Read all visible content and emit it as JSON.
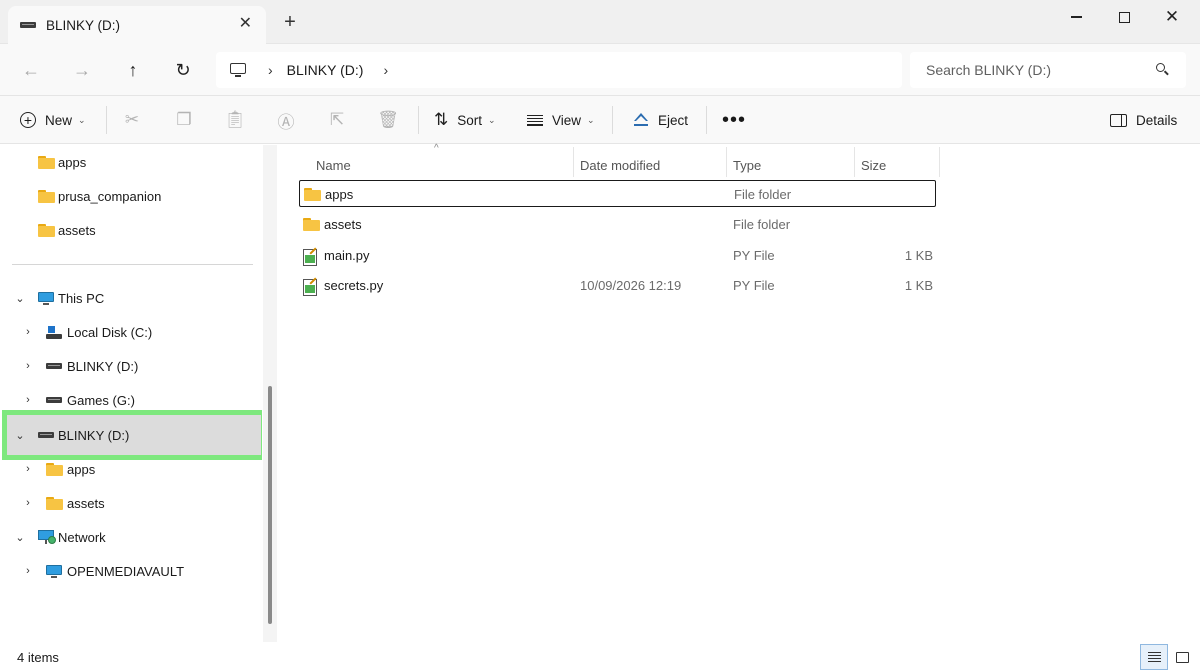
{
  "window": {
    "tab_title": "BLINKY (D:)",
    "tab_close": "✕",
    "new_tab": "+",
    "minimize_icon": "minimize-icon",
    "maximize_icon": "maximize-icon",
    "close_glyph": "✕"
  },
  "navigation": {
    "back": "←",
    "forward": "→",
    "up": "↑",
    "refresh": "↻"
  },
  "address": {
    "separator": "›",
    "crumb": "BLINKY (D:)"
  },
  "search": {
    "placeholder": "Search BLINKY (D:)"
  },
  "toolbar": {
    "new_label": "New",
    "sort_label": "Sort",
    "view_label": "View",
    "eject_label": "Eject",
    "more_label": "•••",
    "details_label": "Details",
    "caret": "⌄",
    "icons": [
      "cut-icon",
      "copy-icon",
      "paste-icon",
      "rename-icon",
      "share-icon",
      "delete-icon"
    ]
  },
  "sidebar": {
    "quick": [
      {
        "label": "apps",
        "icon": "folder-icon"
      },
      {
        "label": "prusa_companion",
        "icon": "folder-icon"
      },
      {
        "label": "assets",
        "icon": "folder-icon"
      }
    ],
    "this_pc": "This PC",
    "pc_children": [
      {
        "label": "Local Disk (C:)",
        "icon": "local-disk-icon"
      },
      {
        "label": "BLINKY (D:)",
        "icon": "drive-icon"
      },
      {
        "label": "Games (G:)",
        "icon": "drive-icon"
      }
    ],
    "selected": "BLINKY (D:)",
    "selected_children": [
      {
        "label": "apps",
        "icon": "folder-icon"
      },
      {
        "label": "assets",
        "icon": "folder-icon"
      }
    ],
    "network": "Network",
    "network_children": [
      {
        "label": "OPENMEDIAVAULT",
        "icon": "monitor-icon"
      }
    ],
    "chevron_collapsed": "›",
    "chevron_expanded": "⌄"
  },
  "columns": {
    "name": "Name",
    "date_modified": "Date modified",
    "type": "Type",
    "size": "Size",
    "sort_indicator": "^"
  },
  "files": [
    {
      "name": "apps",
      "date": "",
      "type": "File folder",
      "size": "",
      "icon": "folder-icon"
    },
    {
      "name": "assets",
      "date": "",
      "type": "File folder",
      "size": "",
      "icon": "folder-icon"
    },
    {
      "name": "main.py",
      "date": "",
      "type": "PY File",
      "size": "1 KB",
      "icon": "python-file-icon"
    },
    {
      "name": "secrets.py",
      "date": "10/09/2026 12:19",
      "type": "PY File",
      "size": "1 KB",
      "icon": "python-file-icon"
    }
  ],
  "status": {
    "item_count": "4 items"
  }
}
